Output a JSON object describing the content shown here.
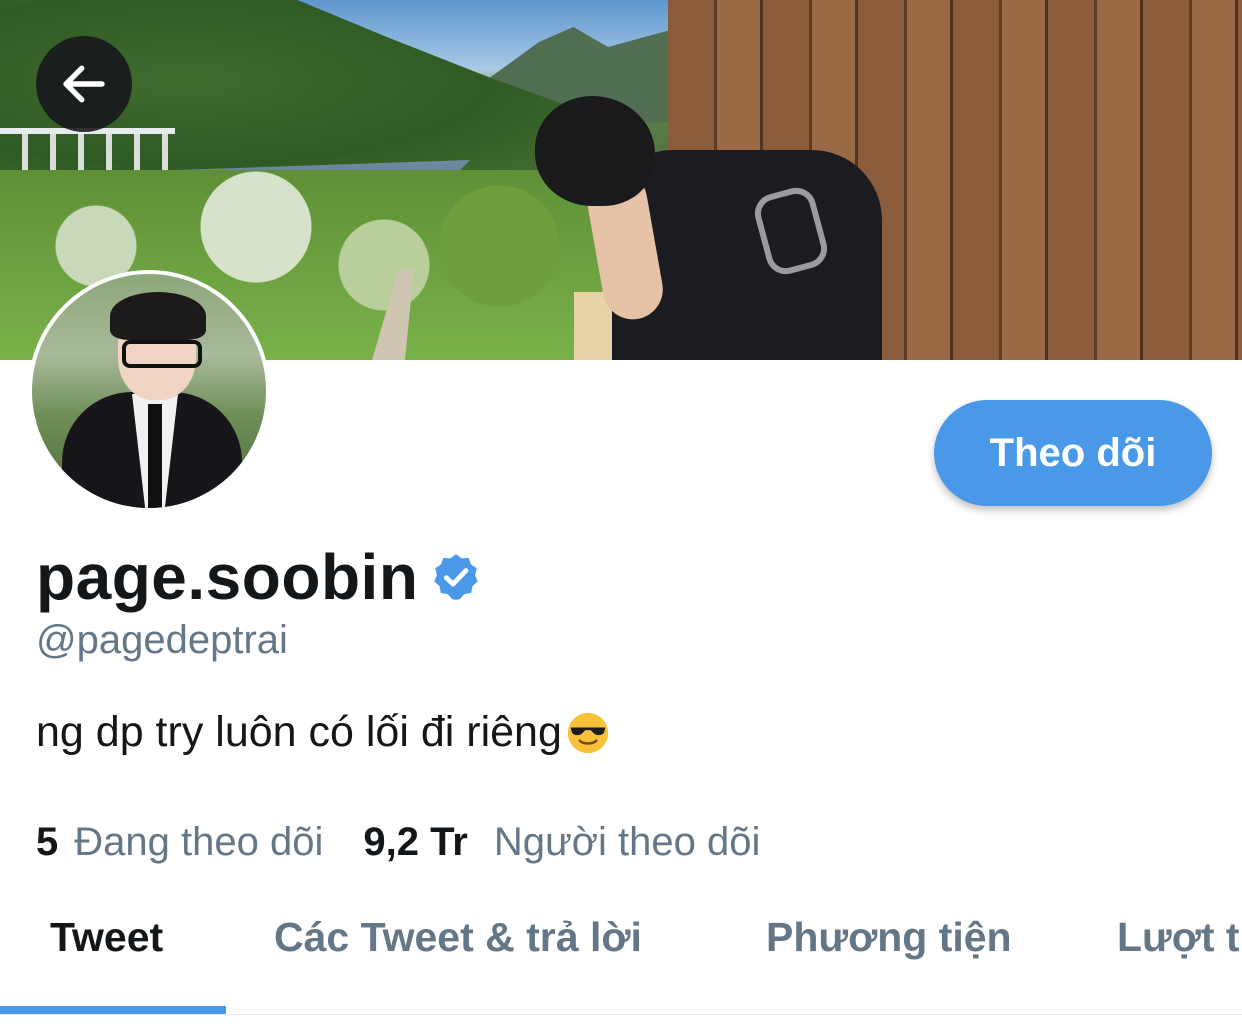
{
  "header": {
    "back_icon": "arrow-left-icon"
  },
  "profile": {
    "display_name": "page.soobin",
    "verified_icon": "verified-badge-icon",
    "handle": "@pagedeptrai",
    "bio": "ng dp try luôn có lối đi riêng",
    "bio_emoji": "smiling-face-with-sunglasses-icon",
    "follow_button": "Theo dõi",
    "following_count": "5",
    "following_label": "Đang theo dõi",
    "followers_count": "9,2 Tr",
    "followers_label": "Người theo dõi"
  },
  "tabs": [
    {
      "label": "Tweet",
      "active": true
    },
    {
      "label": "Các Tweet & trả lời",
      "active": false
    },
    {
      "label": "Phương tiện",
      "active": false
    },
    {
      "label": "Lượt t",
      "active": false
    }
  ],
  "colors": {
    "accent": "#4a99e9",
    "text_primary": "#14171a",
    "text_secondary": "#657786",
    "verified": "#4a99e9"
  }
}
